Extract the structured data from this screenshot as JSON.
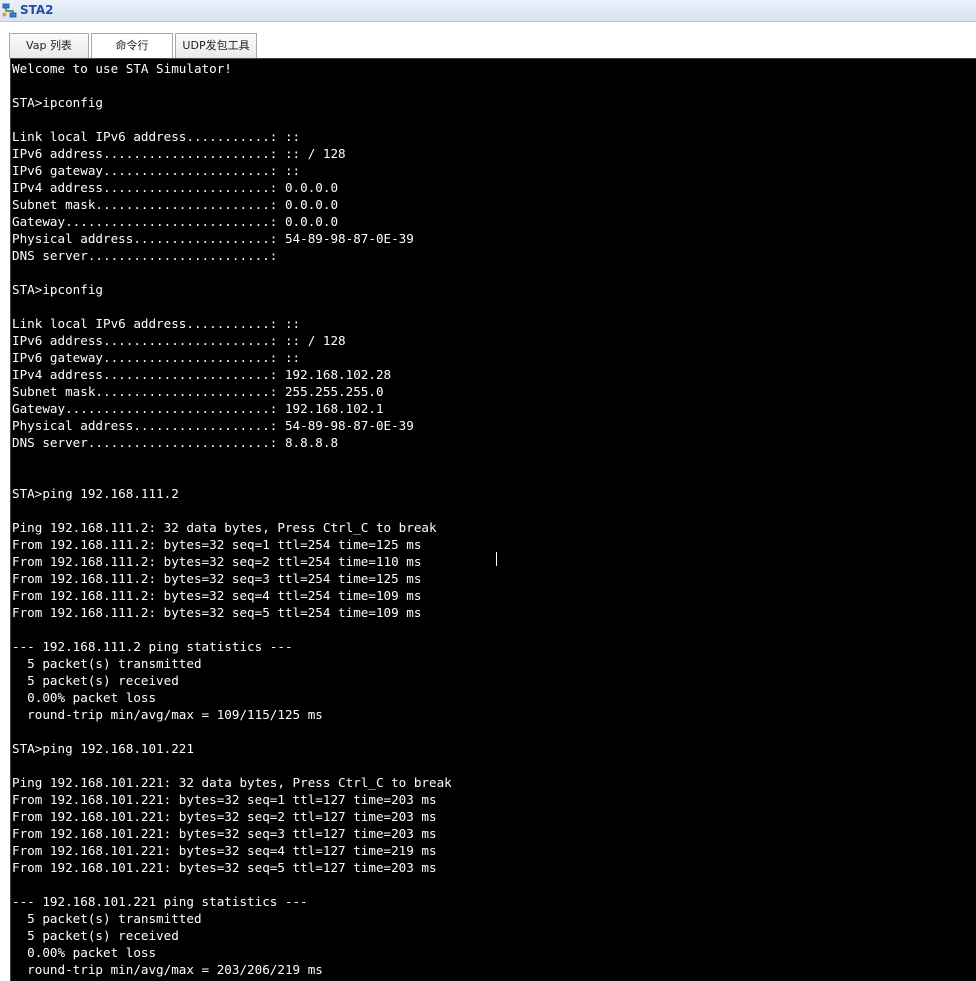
{
  "window": {
    "title": "STA2",
    "icon": "network-station-icon"
  },
  "tabs": [
    {
      "label": "Vap 列表",
      "active": false
    },
    {
      "label": "命令行",
      "active": true
    },
    {
      "label": "UDP发包工具",
      "active": false
    }
  ],
  "console": {
    "lines": [
      "Welcome to use STA Simulator!",
      "",
      "STA>ipconfig",
      "",
      "Link local IPv6 address...........: ::",
      "IPv6 address......................: :: / 128",
      "IPv6 gateway......................: ::",
      "IPv4 address......................: 0.0.0.0",
      "Subnet mask.......................: 0.0.0.0",
      "Gateway...........................: 0.0.0.0",
      "Physical address..................: 54-89-98-87-0E-39",
      "DNS server........................:",
      "",
      "STA>ipconfig",
      "",
      "Link local IPv6 address...........: ::",
      "IPv6 address......................: :: / 128",
      "IPv6 gateway......................: ::",
      "IPv4 address......................: 192.168.102.28",
      "Subnet mask.......................: 255.255.255.0",
      "Gateway...........................: 192.168.102.1",
      "Physical address..................: 54-89-98-87-0E-39",
      "DNS server........................: 8.8.8.8",
      "",
      "",
      "STA>ping 192.168.111.2",
      "",
      "Ping 192.168.111.2: 32 data bytes, Press Ctrl_C to break",
      "From 192.168.111.2: bytes=32 seq=1 ttl=254 time=125 ms",
      "From 192.168.111.2: bytes=32 seq=2 ttl=254 time=110 ms",
      "From 192.168.111.2: bytes=32 seq=3 ttl=254 time=125 ms",
      "From 192.168.111.2: bytes=32 seq=4 ttl=254 time=109 ms",
      "From 192.168.111.2: bytes=32 seq=5 ttl=254 time=109 ms",
      "",
      "--- 192.168.111.2 ping statistics ---",
      "  5 packet(s) transmitted",
      "  5 packet(s) received",
      "  0.00% packet loss",
      "  round-trip min/avg/max = 109/115/125 ms",
      "",
      "STA>ping 192.168.101.221",
      "",
      "Ping 192.168.101.221: 32 data bytes, Press Ctrl_C to break",
      "From 192.168.101.221: bytes=32 seq=1 ttl=127 time=203 ms",
      "From 192.168.101.221: bytes=32 seq=2 ttl=127 time=203 ms",
      "From 192.168.101.221: bytes=32 seq=3 ttl=127 time=203 ms",
      "From 192.168.101.221: bytes=32 seq=4 ttl=127 time=219 ms",
      "From 192.168.101.221: bytes=32 seq=5 ttl=127 time=203 ms",
      "",
      "--- 192.168.101.221 ping statistics ---",
      "  5 packet(s) transmitted",
      "  5 packet(s) received",
      "  0.00% packet loss",
      "  round-trip min/avg/max = 203/206/219 ms"
    ]
  }
}
